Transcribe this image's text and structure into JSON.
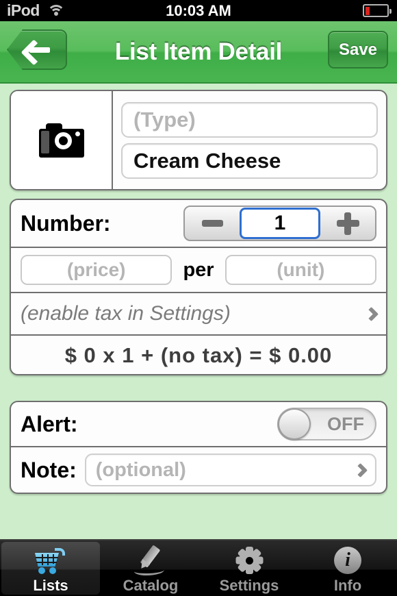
{
  "status_bar": {
    "carrier": "iPod",
    "time": "10:03 AM",
    "wifi_icon": "wifi-icon",
    "battery_icon": "battery-low-icon"
  },
  "nav_bar": {
    "title": "List Item Detail",
    "back_icon": "back-arrow-icon",
    "save_label": "Save",
    "accent_color": "#3fae47"
  },
  "item_card": {
    "photo_icon": "camera-icon",
    "type_placeholder": "(Type)",
    "name_value": "Cream Cheese"
  },
  "detail_card": {
    "number_label": "Number:",
    "decrement_icon": "minus-icon",
    "increment_icon": "plus-icon",
    "number_value": "1",
    "price_placeholder": "(price)",
    "per_label": "per",
    "unit_placeholder": "(unit)",
    "tax_text": "(enable tax in Settings)",
    "tax_chevron_icon": "chevron-right-icon",
    "total_text": "$ 0  x  1  +  (no tax)  =  $ 0.00"
  },
  "options_card": {
    "alert_label": "Alert:",
    "alert_state": "OFF",
    "note_label": "Note:",
    "note_placeholder": "(optional)",
    "note_chevron_icon": "chevron-right-icon"
  },
  "tab_bar": {
    "tabs": [
      {
        "label": "Lists",
        "icon": "shopping-cart-icon",
        "selected": true
      },
      {
        "label": "Catalog",
        "icon": "pencil-icon",
        "selected": false
      },
      {
        "label": "Settings",
        "icon": "gear-icon",
        "selected": false
      },
      {
        "label": "Info",
        "icon": "info-circle-icon",
        "selected": false
      }
    ]
  },
  "colors": {
    "background": "#cdedcb",
    "nav_green": "#3fae47",
    "focus_blue": "#2f6fd0",
    "tab_accent": "#3aa9e0"
  }
}
